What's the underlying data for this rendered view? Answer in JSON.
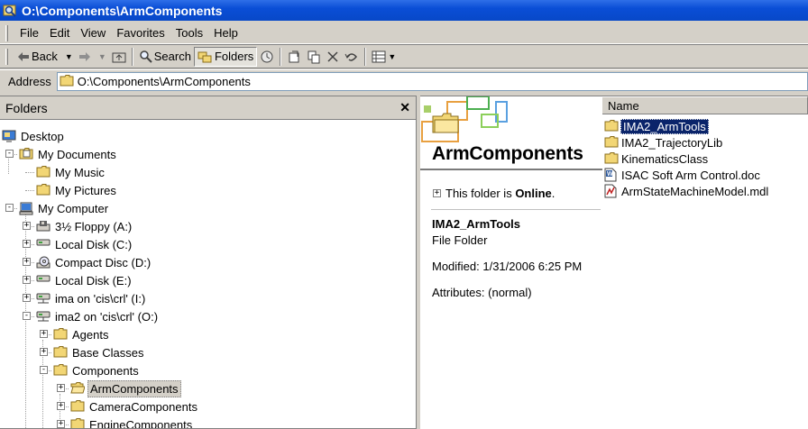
{
  "window": {
    "title": "O:\\Components\\ArmComponents"
  },
  "menu": [
    "File",
    "Edit",
    "View",
    "Favorites",
    "Tools",
    "Help"
  ],
  "toolbar": {
    "back": "Back",
    "search": "Search",
    "folders": "Folders"
  },
  "address": {
    "label": "Address",
    "value": "O:\\Components\\ArmComponents"
  },
  "folders_pane": {
    "title": "Folders",
    "tree": [
      {
        "label": "Desktop",
        "icon": "desktop-icon"
      },
      {
        "label": "My Documents",
        "icon": "my-documents-icon"
      },
      {
        "label": "My Music",
        "icon": "folder-icon"
      },
      {
        "label": "My Pictures",
        "icon": "folder-icon"
      },
      {
        "label": "My Computer",
        "icon": "my-computer-icon"
      },
      {
        "label": "3½ Floppy (A:)",
        "icon": "floppy-icon"
      },
      {
        "label": "Local Disk (C:)",
        "icon": "disk-icon"
      },
      {
        "label": "Compact Disc (D:)",
        "icon": "cd-icon"
      },
      {
        "label": "Local Disk (E:)",
        "icon": "disk-icon"
      },
      {
        "label": "ima on 'cis\\crl' (I:)",
        "icon": "network-drive-icon"
      },
      {
        "label": "ima2 on 'cis\\crl' (O:)",
        "icon": "network-drive-icon"
      },
      {
        "label": "Agents",
        "icon": "folder-icon"
      },
      {
        "label": "Base Classes",
        "icon": "folder-icon"
      },
      {
        "label": "Components",
        "icon": "folder-icon"
      },
      {
        "label": "ArmComponents",
        "icon": "open-folder-icon"
      },
      {
        "label": "CameraComponents",
        "icon": "folder-icon"
      },
      {
        "label": "EngineComponents",
        "icon": "folder-icon"
      }
    ]
  },
  "details": {
    "folder_title": "ArmComponents",
    "online_prefix": "This folder is ",
    "online_status": "Online",
    "online_suffix": ".",
    "selected_name": "IMA2_ArmTools",
    "selected_type": "File Folder",
    "modified": "Modified: 1/31/2006 6:25 PM",
    "attributes": "Attributes: (normal)"
  },
  "file_list": {
    "column_name": "Name",
    "items": [
      {
        "name": "IMA2_ArmTools",
        "icon": "folder-icon"
      },
      {
        "name": "IMA2_TrajectoryLib",
        "icon": "folder-icon"
      },
      {
        "name": "KinematicsClass",
        "icon": "folder-icon"
      },
      {
        "name": "ISAC Soft Arm Control.doc",
        "icon": "word-document-icon"
      },
      {
        "name": "ArmStateMachineModel.mdl",
        "icon": "mdl-file-icon"
      }
    ]
  },
  "colors": {
    "titlebar": "#0a4ed6",
    "selection": "#0a246a",
    "folder": "#f2d675"
  }
}
